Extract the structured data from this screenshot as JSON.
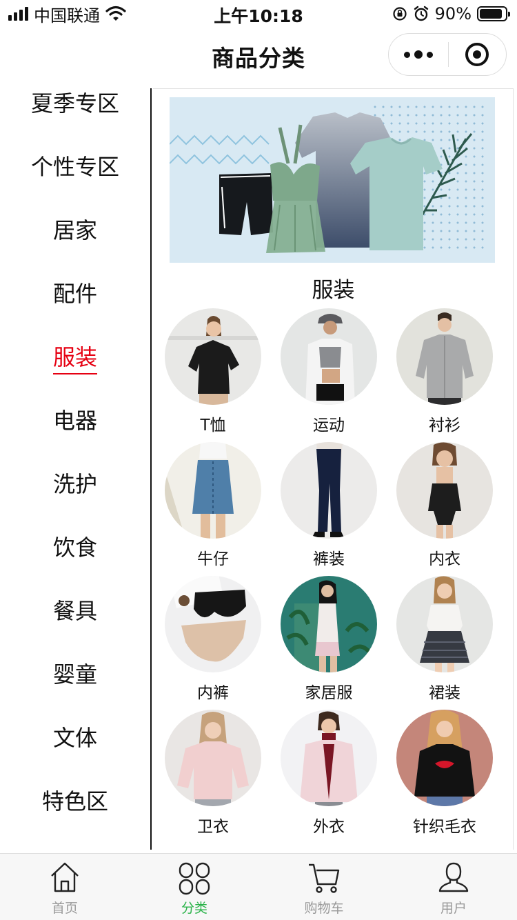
{
  "status_bar": {
    "carrier": "中国联通",
    "time": "上午10:18",
    "battery_percent": "90%",
    "battery_level": 0.9,
    "icons": [
      "signal-icon",
      "wifi-icon",
      "orientation-lock-icon",
      "alarm-icon",
      "battery-icon"
    ]
  },
  "nav": {
    "title": "商品分类",
    "capsule_icons": [
      "more-icon",
      "close-target-icon"
    ]
  },
  "sidebar": {
    "active_index": 4,
    "items": [
      {
        "label": "夏季专区"
      },
      {
        "label": "个性专区"
      },
      {
        "label": "居家"
      },
      {
        "label": "配件"
      },
      {
        "label": "服装"
      },
      {
        "label": "电器"
      },
      {
        "label": "洗护"
      },
      {
        "label": "饮食"
      },
      {
        "label": "餐具"
      },
      {
        "label": "婴童"
      },
      {
        "label": "文体"
      },
      {
        "label": "特色区"
      }
    ]
  },
  "content": {
    "category_title": "服装",
    "items": [
      {
        "label": "T恤"
      },
      {
        "label": "运动"
      },
      {
        "label": "衬衫"
      },
      {
        "label": "牛仔"
      },
      {
        "label": "裤装"
      },
      {
        "label": "内衣"
      },
      {
        "label": "内裤"
      },
      {
        "label": "家居服"
      },
      {
        "label": "裙装"
      },
      {
        "label": "卫衣"
      },
      {
        "label": "外衣"
      },
      {
        "label": "针织毛衣"
      }
    ]
  },
  "tab_bar": {
    "active_index": 1,
    "tabs": [
      {
        "label": "首页",
        "icon": "home-icon"
      },
      {
        "label": "分类",
        "icon": "category-icon"
      },
      {
        "label": "购物车",
        "icon": "cart-icon"
      },
      {
        "label": "用户",
        "icon": "user-icon"
      }
    ]
  },
  "colors": {
    "active_category": "#e60012",
    "active_tab": "#2bb34a",
    "inactive_tab": "#999999",
    "banner_background": "#d8e9f3"
  }
}
